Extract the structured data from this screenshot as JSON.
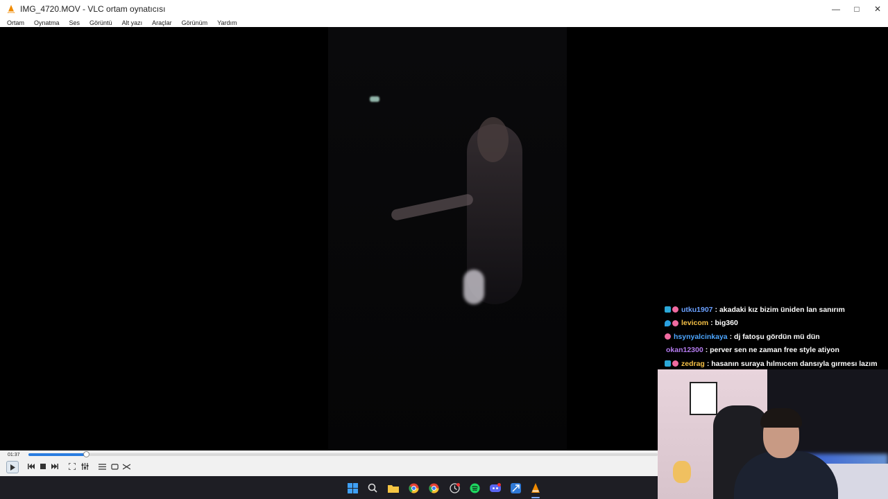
{
  "window": {
    "title": "IMG_4720.MOV - VLC ortam oynatıcısı",
    "controls": [
      "minimize",
      "maximize",
      "close"
    ]
  },
  "menu": {
    "items": [
      "Ortam",
      "Oynatma",
      "Ses",
      "Görüntü",
      "Alt yazı",
      "Araçlar",
      "Görünüm",
      "Yardım"
    ]
  },
  "player": {
    "elapsed": "01:37",
    "progress": 0.092
  },
  "chat": {
    "messages": [
      {
        "badges": [
          "prime",
          "heart"
        ],
        "user": "utku1907",
        "user_color": "#6aa0ff",
        "text": ": akadaki kız bizim üniden lan sanırım"
      },
      {
        "badges": [
          "drop",
          "heart"
        ],
        "user": "levicom",
        "user_color": "#f5c046",
        "text": ": big360"
      },
      {
        "badges": [
          "heart"
        ],
        "user": "hsynyalcinkaya",
        "user_color": "#4da6ff",
        "text": ": dj fatoşu gördün mü dün"
      },
      {
        "badges": [],
        "user": "okan12300",
        "user_color": "#b57cf0",
        "text": ": perver sen ne zaman free style atiyon"
      },
      {
        "badges": [
          "prime",
          "heart"
        ],
        "user": "zedrag",
        "user_color": "#f5c046",
        "text": ": hasanın suraya hılmıcem dansıyla gırmesı lazım"
      }
    ]
  },
  "icons": {
    "control_buttons": [
      "play-icon",
      "previous-icon",
      "stop-icon",
      "next-icon",
      "fullscreen-icon",
      "extended-settings-icon",
      "playlist-icon",
      "loop-icon",
      "shuffle-icon"
    ],
    "taskbar": [
      "windows-start-icon",
      "search-icon",
      "file-explorer-icon",
      "chrome-icon",
      "chrome-icon",
      "clock-app-icon",
      "spotify-icon",
      "discord-icon",
      "app-icon",
      "vlc-icon"
    ]
  },
  "colors": {
    "seek_fill": "#2a7de0",
    "vlc_orange": "#f08a00"
  }
}
